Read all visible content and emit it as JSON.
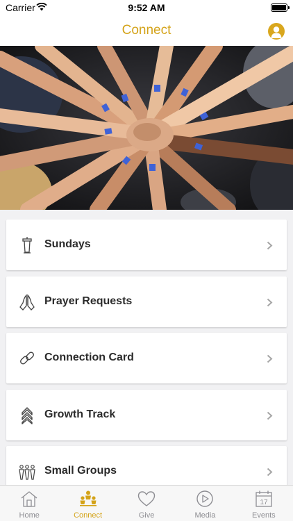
{
  "status_bar": {
    "carrier": "Carrier",
    "time": "9:52 AM"
  },
  "nav": {
    "title": "Connect",
    "profile_icon": "person-icon"
  },
  "hero": {
    "description_icon": "hands-together-photo"
  },
  "menu": {
    "items": [
      {
        "label": "Sundays",
        "icon": "pulpit-icon"
      },
      {
        "label": "Prayer Requests",
        "icon": "praying-hands-icon"
      },
      {
        "label": "Connection Card",
        "icon": "link-icon"
      },
      {
        "label": "Growth Track",
        "icon": "chevrons-up-icon"
      },
      {
        "label": "Small Groups",
        "icon": "people-group-icon"
      }
    ]
  },
  "tabs": [
    {
      "label": "Home",
      "icon": "home-icon",
      "active": false
    },
    {
      "label": "Connect",
      "icon": "connect-people-icon",
      "active": true
    },
    {
      "label": "Give",
      "icon": "heart-icon",
      "active": false
    },
    {
      "label": "Media",
      "icon": "play-icon",
      "active": false
    },
    {
      "label": "Events",
      "icon": "calendar-icon",
      "active": false,
      "calendar_day": "17"
    }
  ],
  "colors": {
    "accent": "#d4a319",
    "inactive": "#8e8e93",
    "background": "#f1f1f3"
  }
}
